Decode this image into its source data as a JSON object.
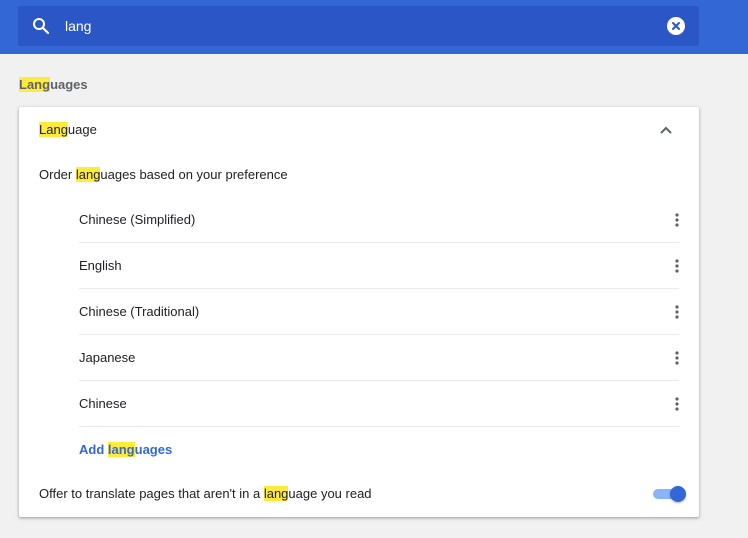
{
  "search": {
    "value": "lang",
    "icon": "search-icon",
    "clear_icon": "close-icon"
  },
  "section": {
    "title_highlight": "Lang",
    "title_rest": "uages"
  },
  "card": {
    "header_highlight": "Lang",
    "header_rest": "uage",
    "header_state": "expanded",
    "order_pre": "Order ",
    "order_highlight": "lang",
    "order_rest": "uages based on your preference",
    "languages": [
      {
        "name": "Chinese (Simplified)"
      },
      {
        "name": "English"
      },
      {
        "name": "Chinese (Traditional)"
      },
      {
        "name": "Japanese"
      },
      {
        "name": "Chinese"
      }
    ],
    "add_pre": "Add ",
    "add_highlight": "lang",
    "add_rest": "uages",
    "offer_pre": "Offer to translate pages that aren't in a ",
    "offer_highlight": "lang",
    "offer_rest": "uage you read",
    "offer_toggle_on": true
  },
  "colors": {
    "header_bg": "#3367d6",
    "highlight": "#ffeb3b",
    "link": "#3367d6"
  }
}
